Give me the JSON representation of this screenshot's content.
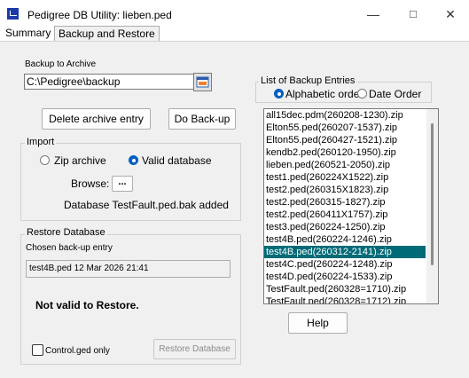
{
  "window": {
    "title": "Pedigree DB Utility: lieben.ped",
    "minimize": "—",
    "maximize": "□",
    "close": "✕"
  },
  "tabs": [
    {
      "label": "Summary"
    },
    {
      "label": "Backup and Restore"
    }
  ],
  "backup": {
    "section_label": "Backup to Archive",
    "path_value": "C:\\Pedigree\\backup",
    "delete_label": "Delete archive entry",
    "backup_label": "Do Back-up"
  },
  "import": {
    "legend": "Import",
    "zip_label": "Zip archive",
    "valid_label": "Valid database",
    "browse_label": "Browse:",
    "browse_button": "...",
    "status": "Database TestFault.ped.bak added"
  },
  "restore": {
    "legend": "Restore Database",
    "chosen_label": "Chosen back-up entry",
    "chosen_value": "test4B.ped 12 Mar 2026 21:41",
    "status": "Not valid to Restore.",
    "control_label": "Control.ged only",
    "restore_button": "Restore Database"
  },
  "list": {
    "legend": "List of Backup Entries",
    "alpha_label": "Alphabetic order",
    "date_label": "Date Order",
    "items": [
      "all15dec.pdm(260208-1230).zip",
      "Elton55.ped(260207-1537).zip",
      "Elton55.ped(260427-1521).zip",
      "kendb2.ped(260120-1950).zip",
      "lieben.ped(260521-2050).zip",
      "test1.ped(260224X1522).zip",
      "test2.ped(260315X1823).zip",
      "test2.ped(260315-1827).zip",
      "test2.ped(260411X1757).zip",
      "test3.ped(260224-1250).zip",
      "test4B.ped(260224-1246).zip",
      "test4B.ped(260312-2141).zip",
      "test4C.ped(260224-1248).zip",
      "test4D.ped(260224-1533).zip",
      "TestFault.ped(260328=1710).zip",
      "TestFault.ped(260328=1712).zip"
    ],
    "selected_index": 11
  },
  "help_label": "Help"
}
